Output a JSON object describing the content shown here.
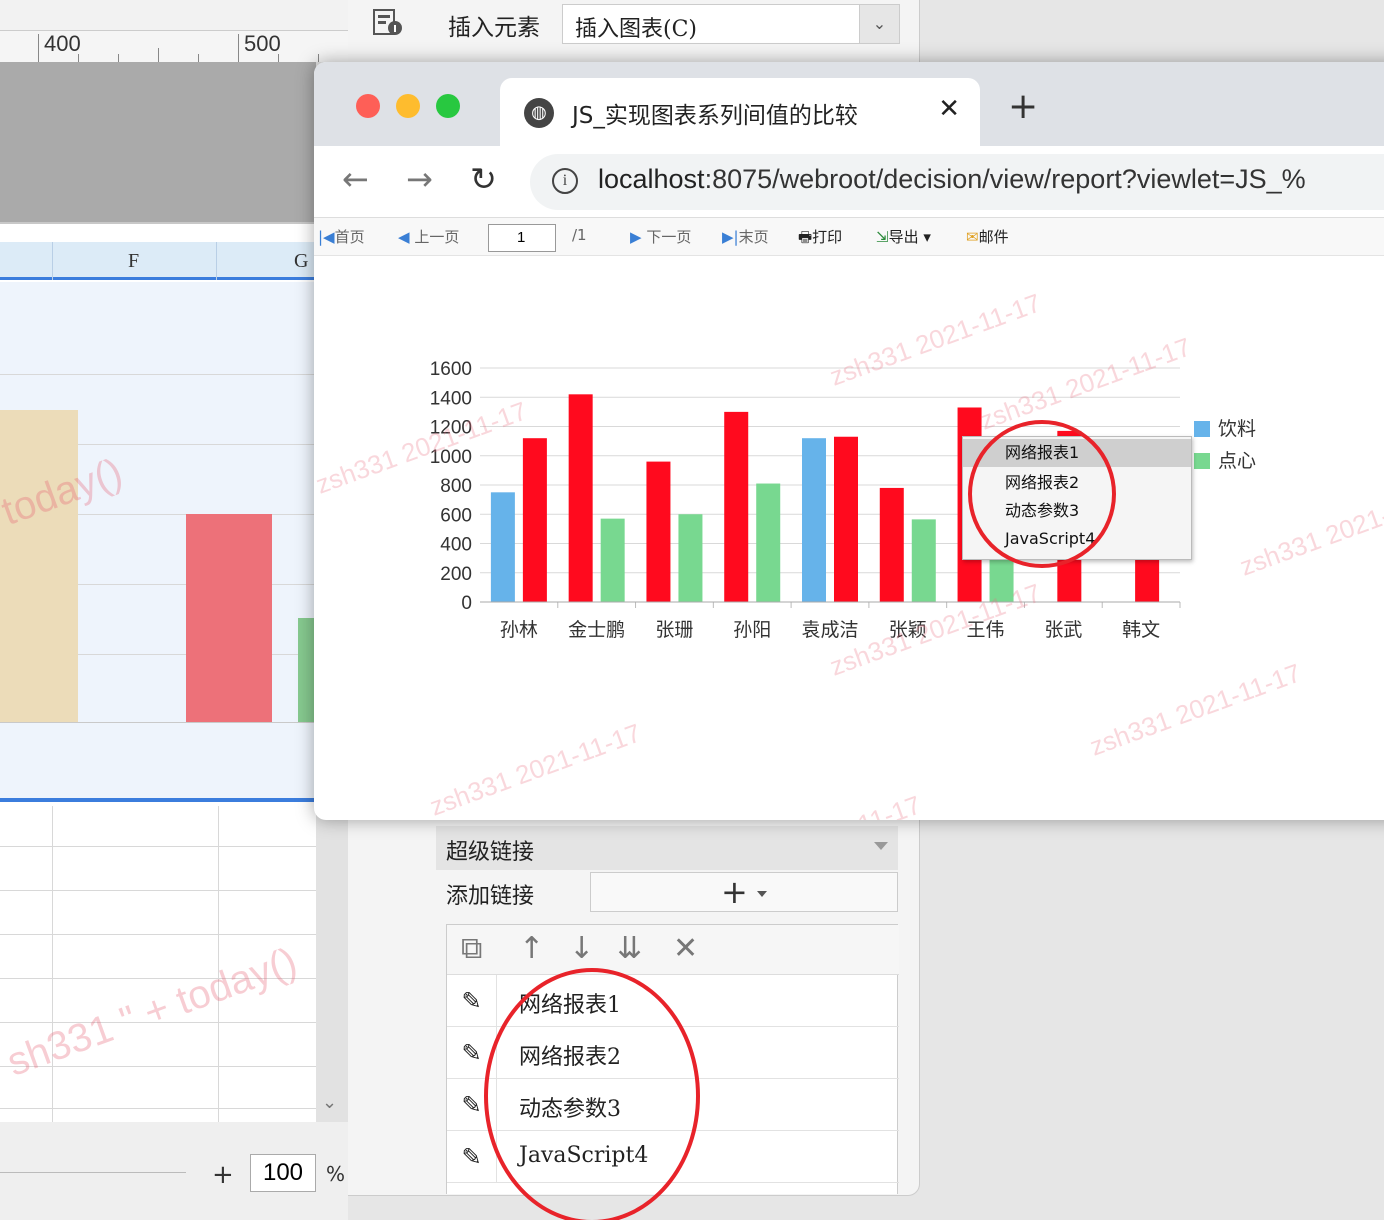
{
  "designer": {
    "ruler_ticks": [
      "400",
      "500"
    ],
    "columns": [
      "F",
      "G"
    ],
    "zoom_value": "100",
    "zoom_unit": "%"
  },
  "panel": {
    "insert_label": "插入元素",
    "insert_select_value": "插入图表(C)",
    "hyperlink_section": "超级链接",
    "add_link_label": "添加链接",
    "links": [
      "网络报表1",
      "网络报表2",
      "动态参数3",
      "JavaScript4"
    ]
  },
  "browser": {
    "tab_title": "JS_实现图表系列间值的比较",
    "url_host": "localhost",
    "url_rest": ":8075/webroot/decision/view/report?viewlet=JS_%",
    "toolbar": {
      "first": "首页",
      "prev": "上一页",
      "page": "1",
      "total": "/1",
      "next": "下一页",
      "last": "末页",
      "print": "打印",
      "export": "导出",
      "mail": "邮件"
    }
  },
  "watermark": "zsh331 2021-11-17",
  "chart_data": {
    "type": "bar",
    "categories": [
      "孙林",
      "金士鹏",
      "张珊",
      "孙阳",
      "袁成洁",
      "张颖",
      "王伟",
      "张武",
      "韩文"
    ],
    "ylim": [
      0,
      1600
    ],
    "yticks": [
      "0",
      "200",
      "400",
      "600",
      "800",
      "1000",
      "1200",
      "1400",
      "1600"
    ],
    "legend_position": "right",
    "grid": true,
    "colors": {
      "blue": "#66b3ea",
      "red": "#ff0a1e",
      "green": "#78d890"
    },
    "bars": [
      [
        {
          "c": "blue",
          "v": 750
        },
        {
          "c": "red",
          "v": 1120
        }
      ],
      [
        {
          "c": "red",
          "v": 1420
        },
        {
          "c": "green",
          "v": 570
        }
      ],
      [
        {
          "c": "red",
          "v": 960
        },
        {
          "c": "green",
          "v": 600
        }
      ],
      [
        {
          "c": "red",
          "v": 1300
        },
        {
          "c": "green",
          "v": 810
        }
      ],
      [
        {
          "c": "blue",
          "v": 1120
        },
        {
          "c": "red",
          "v": 1130
        }
      ],
      [
        {
          "c": "red",
          "v": 780
        },
        {
          "c": "green",
          "v": 565
        }
      ],
      [
        {
          "c": "red",
          "v": 1330
        },
        {
          "c": "green",
          "v": 920
        }
      ],
      [
        {
          "c": "red",
          "v": 1170
        }
      ],
      [
        {
          "c": "red",
          "v": 990
        }
      ]
    ],
    "legend": [
      {
        "name": "饮料",
        "color": "#66b3ea"
      },
      {
        "name": "点心",
        "color": "#78d890"
      }
    ]
  },
  "context_menu": [
    "网络报表1",
    "网络报表2",
    "动态参数3",
    "JavaScript4"
  ]
}
